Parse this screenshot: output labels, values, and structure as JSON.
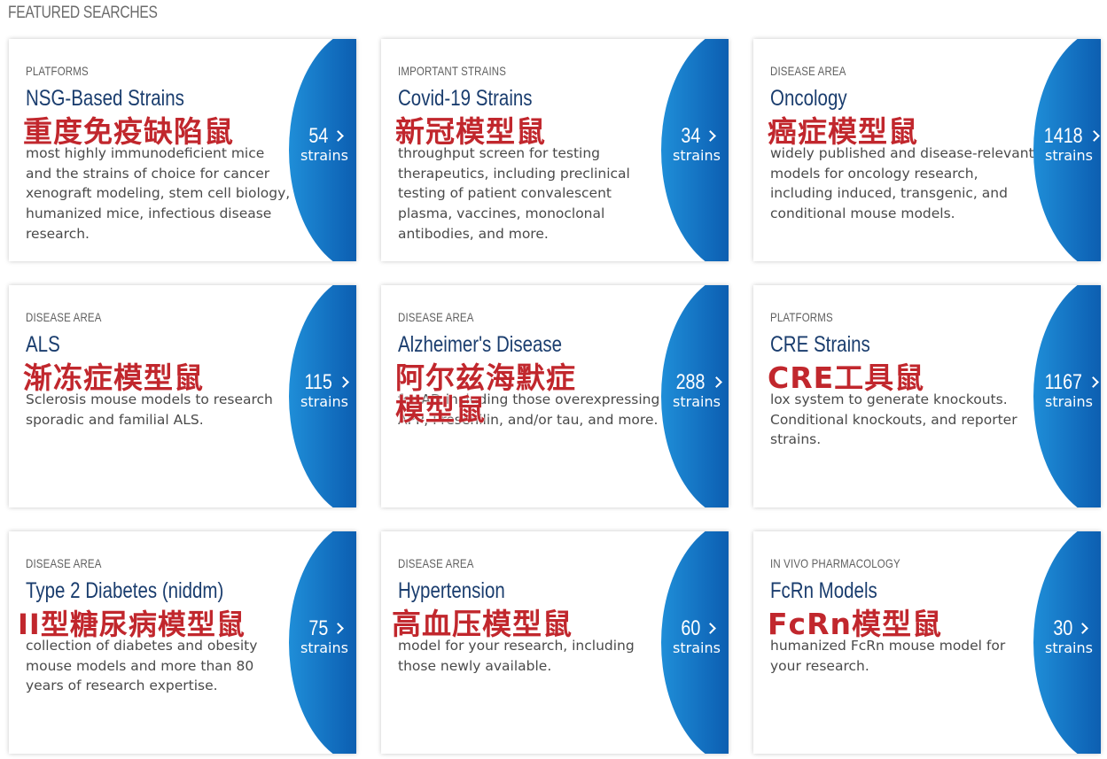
{
  "section_title": "FEATURED SEARCHES",
  "cards": [
    {
      "category": "PLATFORMS",
      "title": "NSG-Based Strains",
      "description": "most highly immunodeficient mice and the strains of choice for cancer xenograft modeling, stem cell biology, humanized mice, infectious disease research.",
      "overlay": "重度免疫缺陷鼠",
      "count": "54",
      "unit": "strains"
    },
    {
      "category": "IMPORTANT STRAINS",
      "title": "Covid-19 Strains",
      "description": "throughput screen for testing therapeutics, including preclinical testing of patient convalescent plasma, vaccines, monoclonal antibodies, and more.",
      "overlay": "新冠模型鼠",
      "count": "34",
      "unit": "strains"
    },
    {
      "category": "DISEASE AREA",
      "title": "Oncology",
      "description": "widely published and disease-relevant models for oncology research, including induced, transgenic, and conditional mouse models.",
      "overlay": "癌症模型鼠",
      "count": "1418",
      "unit": "strains"
    },
    {
      "category": "DISEASE AREA",
      "title": "ALS",
      "description": "Sclerosis mouse models to research sporadic and familial ALS.",
      "overlay": "渐冻症模型鼠",
      "count": "115",
      "unit": "strains"
    },
    {
      "category": "DISEASE AREA",
      "title": "Alzheimer's Disease",
      "description": "for AD including those overexpressing APP, Presenilin, and/or tau, and more.",
      "overlay": "阿尔兹海默症模型鼠",
      "count": "288",
      "unit": "strains"
    },
    {
      "category": "PLATFORMS",
      "title": "CRE Strains",
      "description": "lox system to generate knockouts. Conditional knockouts, and reporter strains.",
      "overlay": "CRE工具鼠",
      "count": "1167",
      "unit": "strains"
    },
    {
      "category": "DISEASE AREA",
      "title": "Type 2 Diabetes (niddm)",
      "description": "collection of diabetes and obesity mouse models and more than 80 years of research expertise.",
      "overlay": "II型糖尿病模型鼠",
      "count": "75",
      "unit": "strains"
    },
    {
      "category": "DISEASE AREA",
      "title": "Hypertension",
      "description": "model for your research, including those newly available.",
      "overlay": "高血压模型鼠",
      "count": "60",
      "unit": "strains"
    },
    {
      "category": "IN VIVO PHARMACOLOGY",
      "title": "FcRn Models",
      "description": "humanized FcRn mouse model for your research.",
      "overlay": "FcRn模型鼠",
      "count": "30",
      "unit": "strains"
    }
  ],
  "colors": {
    "title": "#1a3d6e",
    "overlay_text": "#c1272d",
    "oval_dark": "#05306f",
    "oval_light": "#1f8ed8"
  }
}
